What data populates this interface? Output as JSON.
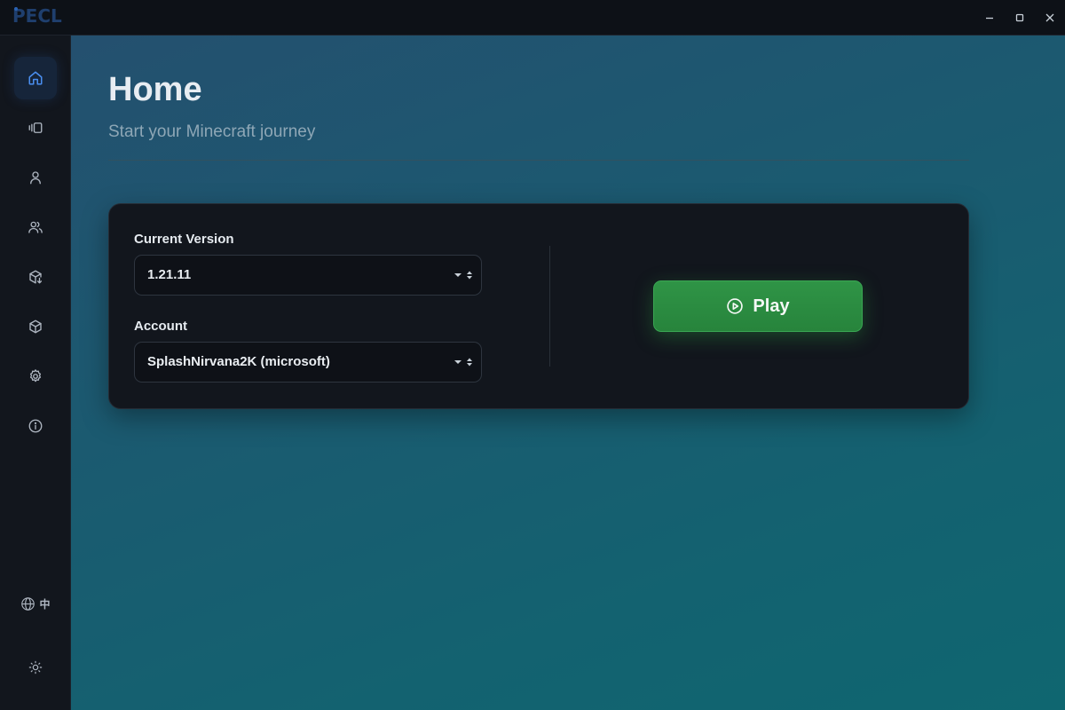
{
  "app": {
    "logo_text": "PECL"
  },
  "window_controls": [
    "minimize-icon",
    "maximize-icon",
    "close-icon"
  ],
  "sidebar": {
    "items": [
      {
        "id": "home",
        "icon": "home-icon",
        "active": true
      },
      {
        "id": "versions",
        "icon": "versions-icon",
        "active": false
      },
      {
        "id": "account",
        "icon": "user-icon",
        "active": false
      },
      {
        "id": "accounts",
        "icon": "users-icon",
        "active": false
      },
      {
        "id": "mod-download",
        "icon": "package-download-icon",
        "active": false
      },
      {
        "id": "resources",
        "icon": "cube-icon",
        "active": false
      },
      {
        "id": "settings",
        "icon": "gear-icon",
        "active": false
      },
      {
        "id": "about",
        "icon": "info-icon",
        "active": false
      }
    ],
    "language_label": "中",
    "language_icon": "globe-icon",
    "theme_icon": "sun-icon"
  },
  "main": {
    "title": "Home",
    "subtitle": "Start your Minecraft journey",
    "launch_card": {
      "version_label": "Current Version",
      "version_value": "1.21.11",
      "account_label": "Account",
      "account_value": "SplashNirvana2K (microsoft)",
      "play_label": "Play",
      "play_icon": "play-circle-icon"
    }
  },
  "colors": {
    "accent_blue": "#3b82f6",
    "play_green": "#2f9446",
    "card_bg": "#12161d"
  }
}
